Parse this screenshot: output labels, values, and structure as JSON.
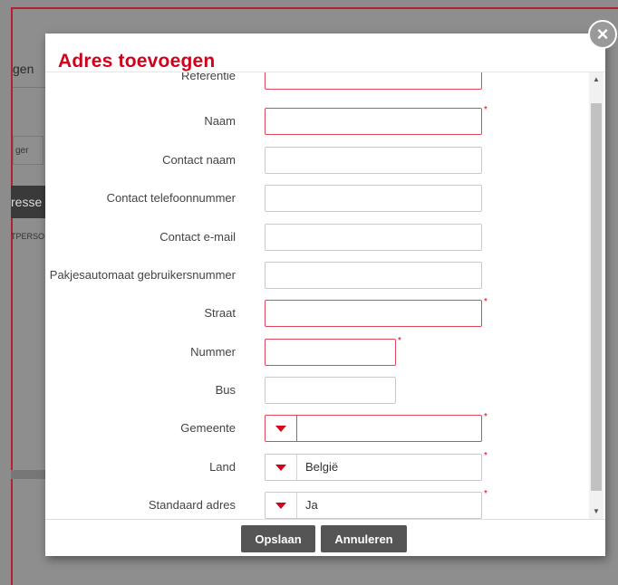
{
  "background": {
    "tab_fragment": "gen",
    "header_fragment": "ger",
    "button_fragment": "resse",
    "small_fragment": "TPERSO"
  },
  "modal": {
    "title": "Adres toevoegen",
    "close_label": "×",
    "required_marker": "*",
    "fields": {
      "referentie": {
        "label": "Referentie",
        "value": "",
        "required": true
      },
      "naam": {
        "label": "Naam",
        "value": "",
        "required": true
      },
      "contact_naam": {
        "label": "Contact naam",
        "value": "",
        "required": false
      },
      "contact_telefoon": {
        "label": "Contact telefoonnummer",
        "value": "",
        "required": false
      },
      "contact_email": {
        "label": "Contact e-mail",
        "value": "",
        "required": false
      },
      "pakjesautomaat": {
        "label": "Pakjesautomaat gebruikersnummer",
        "value": "",
        "required": false
      },
      "straat": {
        "label": "Straat",
        "value": "",
        "required": true
      },
      "nummer": {
        "label": "Nummer",
        "value": "",
        "required": true
      },
      "bus": {
        "label": "Bus",
        "value": "",
        "required": false
      },
      "gemeente": {
        "label": "Gemeente",
        "value": "",
        "required": true
      },
      "land": {
        "label": "Land",
        "value": "België",
        "required": true
      },
      "standaard_adres": {
        "label": "Standaard adres",
        "value": "Ja",
        "required": true
      }
    },
    "buttons": {
      "save": "Opslaan",
      "cancel": "Annuleren"
    }
  },
  "colors": {
    "accent": "#d0021b",
    "required_border": "#e0455a",
    "button_bg": "#555555"
  }
}
